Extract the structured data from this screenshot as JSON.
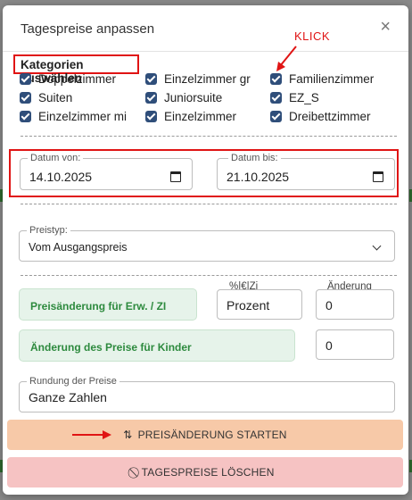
{
  "modal": {
    "title": "Tagespreise anpassen",
    "close_symbol": "×"
  },
  "annotation": {
    "klick": "KLICK"
  },
  "categories": {
    "title": "Kategorien auswählen",
    "items": [
      {
        "label": "Doppelzimmer",
        "checked": true
      },
      {
        "label": "Einzelzimmer gr",
        "checked": true
      },
      {
        "label": "Familienzimmer",
        "checked": true
      },
      {
        "label": "Suiten",
        "checked": true
      },
      {
        "label": "Juniorsuite",
        "checked": true
      },
      {
        "label": "EZ_S",
        "checked": true
      },
      {
        "label": "Einzelzimmer mi",
        "checked": true
      },
      {
        "label": "Einzelzimmer",
        "checked": true
      },
      {
        "label": "Dreibettzimmer",
        "checked": true
      }
    ]
  },
  "dates": {
    "from_label": "Datum von:",
    "from_value": "14.10.2025",
    "to_label": "Datum bis:",
    "to_value": "21.10.2025"
  },
  "price_type": {
    "label": "Preistyp:",
    "value": "Vom Ausgangspreis"
  },
  "price_change": {
    "adult_label": "Preisänderung für Erw. / ZI",
    "unit_label": "%|€|Zi",
    "unit_value": "Prozent",
    "change_label": "Änderung",
    "change_value": "0",
    "child_label": "Änderung des Preise für Kinder",
    "child_value": "0"
  },
  "rounding": {
    "label": "Rundung der Preise",
    "value": "Ganze Zahlen"
  },
  "buttons": {
    "start_label": "PREISÄNDERUNG STARTEN",
    "start_icon": "sort-arrows-icon",
    "delete_label": "TAGESPREISE LÖSCHEN",
    "delete_icon": "ban-icon"
  },
  "colors": {
    "annotation_red": "#e01414",
    "checkbox_blue": "#2f4e7a",
    "start_button": "#f7c9a8",
    "delete_button": "#f6c3c3",
    "green_text": "#2d8a3e"
  }
}
